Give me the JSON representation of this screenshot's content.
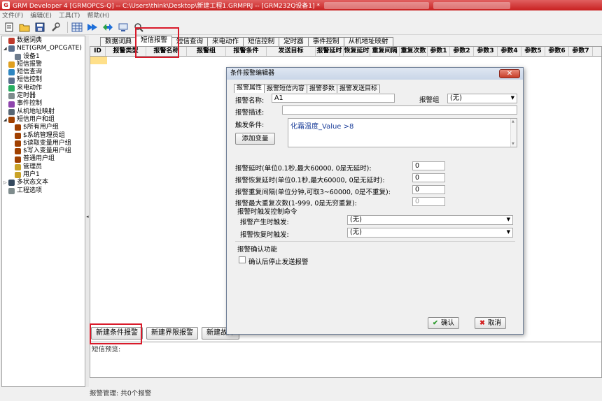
{
  "titlebar": {
    "title": "GRM Developer 4 [GRMOPCS-Q]  -- C:\\Users\\think\\Desktop\\新建工程1.GRMPRJ -- [GRM232Q设备1] *"
  },
  "menu": [
    "文件(F)",
    "编辑(E)",
    "工具(T)",
    "帮助(H)"
  ],
  "tree": [
    {
      "label": "数据词典",
      "indent": 0,
      "exp": "",
      "color": "#c0392b"
    },
    {
      "label": "NET(GRM_OPCGATE)",
      "indent": 0,
      "exp": "◢",
      "color": "#5a6e8c"
    },
    {
      "label": "设备1",
      "indent": 1,
      "exp": "",
      "color": "#6d7b8c"
    },
    {
      "label": "短信报警",
      "indent": 0,
      "exp": "",
      "color": "#e0a020"
    },
    {
      "label": "短信查询",
      "indent": 0,
      "exp": "",
      "color": "#2e86c1"
    },
    {
      "label": "短信控制",
      "indent": 0,
      "exp": "",
      "color": "#5a6e8c"
    },
    {
      "label": "来电动作",
      "indent": 0,
      "exp": "",
      "color": "#27ae60"
    },
    {
      "label": "定时器",
      "indent": 0,
      "exp": "",
      "color": "#7f8c8d"
    },
    {
      "label": "事件控制",
      "indent": 0,
      "exp": "",
      "color": "#8e44ad"
    },
    {
      "label": "从机地址映射",
      "indent": 0,
      "exp": "",
      "color": "#566573"
    },
    {
      "label": "短信用户和组",
      "indent": 0,
      "exp": "◢",
      "color": "#a04000"
    },
    {
      "label": "$所有用户组",
      "indent": 1,
      "exp": "",
      "color": "#a04000"
    },
    {
      "label": "$系统管理员组",
      "indent": 1,
      "exp": "",
      "color": "#a04000"
    },
    {
      "label": "$读取变量用户组",
      "indent": 1,
      "exp": "",
      "color": "#a04000"
    },
    {
      "label": "$写入变量用户组",
      "indent": 1,
      "exp": "",
      "color": "#a04000"
    },
    {
      "label": "普通用户组",
      "indent": 1,
      "exp": "",
      "color": "#a04000"
    },
    {
      "label": "管理员",
      "indent": 1,
      "exp": "",
      "color": "#c9a227"
    },
    {
      "label": "用户1",
      "indent": 1,
      "exp": "",
      "color": "#c9a227"
    },
    {
      "label": "多状态文本",
      "indent": 0,
      "exp": "▷",
      "color": "#34495e"
    },
    {
      "label": "工程选项",
      "indent": 0,
      "exp": "",
      "color": "#7f8c8d"
    }
  ],
  "main_tabs": [
    "数据词典",
    "短信报警",
    "短信查询",
    "来电动作",
    "短信控制",
    "定时器",
    "事件控制",
    "从机地址映射"
  ],
  "active_tab": "短信报警",
  "grid_columns": [
    {
      "label": "ID",
      "w": 22
    },
    {
      "label": "报警类型",
      "w": 58
    },
    {
      "label": "报警名称",
      "w": 58
    },
    {
      "label": "报警组",
      "w": 56
    },
    {
      "label": "报警条件",
      "w": 58
    },
    {
      "label": "发送目标",
      "w": 70
    },
    {
      "label": "报警延时",
      "w": 40
    },
    {
      "label": "恢复延时",
      "w": 38
    },
    {
      "label": "重复间隔",
      "w": 42
    },
    {
      "label": "重复次数",
      "w": 40
    },
    {
      "label": "参数1",
      "w": 32
    },
    {
      "label": "参数2",
      "w": 34
    },
    {
      "label": "参数3",
      "w": 34
    },
    {
      "label": "参数4",
      "w": 34
    },
    {
      "label": "参数5",
      "w": 34
    },
    {
      "label": "参数6",
      "w": 34
    },
    {
      "label": "参数7",
      "w": 34
    }
  ],
  "bottom_buttons": [
    "新建条件报警",
    "新建界限报警",
    "新建故障"
  ],
  "preview_label": "短信预览:",
  "status": "报警管理: 共0个报警",
  "dialog": {
    "title": "条件报警编辑器",
    "close": "✕",
    "tabs": [
      "报警属性",
      "报警短信内容",
      "报警参数",
      "报警发送目标"
    ],
    "alarm_name_label": "报警名称:",
    "alarm_name_value": "A1",
    "alarm_group_label": "报警组",
    "alarm_group_value": "(无)",
    "alarm_desc_label": "报警描述:",
    "trigger_label": "触发条件:",
    "trigger_value": "化霜温度_Value >8",
    "add_var": "添加变量",
    "delay_label": "报警延时(单位0.1秒,最大60000, 0是无延时):",
    "delay_value": "0",
    "recover_label": "报警恢复延时(单位0.1秒,最大60000, 0是无延时):",
    "recover_value": "0",
    "interval_label": "报警重复间隔(单位分钟,可取3~60000, 0是不重复):",
    "interval_value": "0",
    "count_label": "报警最大重复次数(1-999, 0是无穷重复):",
    "count_value": "0",
    "ctrl_group": "报警时触发控制命令",
    "on_alarm_label": "报警产生时触发:",
    "on_alarm_value": "(无)",
    "on_recover_label": "报警恢复时触发:",
    "on_recover_value": "(无)",
    "confirm_group": "报警确认功能",
    "confirm_check": "确认后停止发送报警",
    "ok": "确认",
    "cancel": "取消"
  }
}
